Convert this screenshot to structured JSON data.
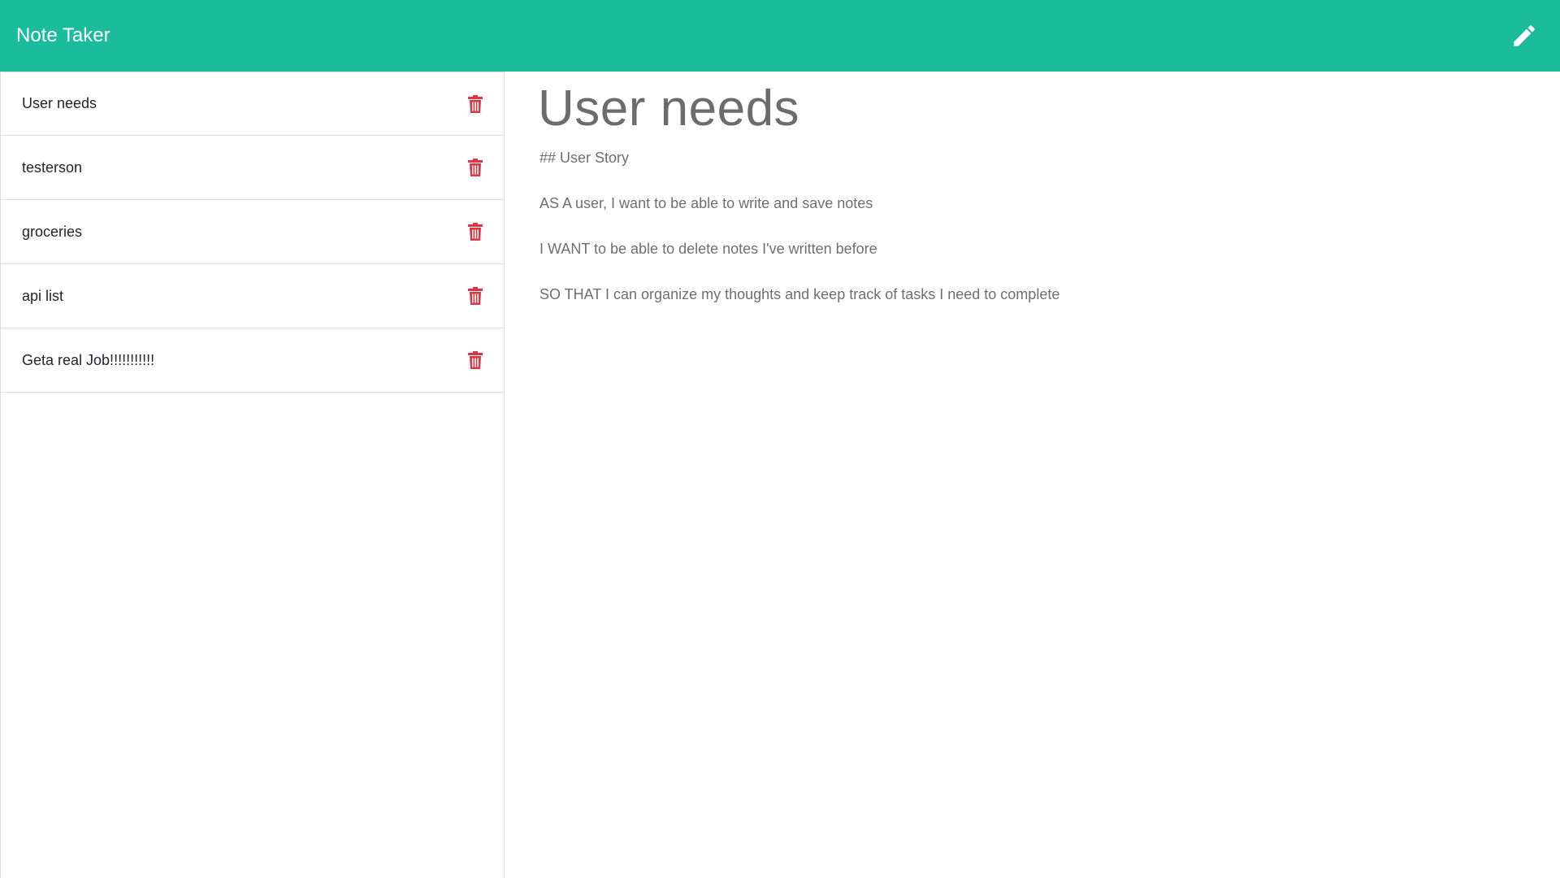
{
  "app": {
    "title": "Note Taker",
    "accent_color": "#1abc9c",
    "new_note_icon": "pencil-icon"
  },
  "sidebar": {
    "delete_icon": "trash-icon",
    "delete_color": "#dc3545",
    "notes": [
      {
        "title": "User needs"
      },
      {
        "title": "testerson"
      },
      {
        "title": "groceries"
      },
      {
        "title": "api list"
      },
      {
        "title": "Geta real Job!!!!!!!!!!!"
      }
    ]
  },
  "active_note": {
    "title": "User needs",
    "lines": [
      "## User Story",
      "AS A user, I want to be able to write and save notes",
      "I WANT to be able to delete notes I've written before",
      "SO THAT I can organize my thoughts and keep track of tasks I need to complete"
    ]
  }
}
